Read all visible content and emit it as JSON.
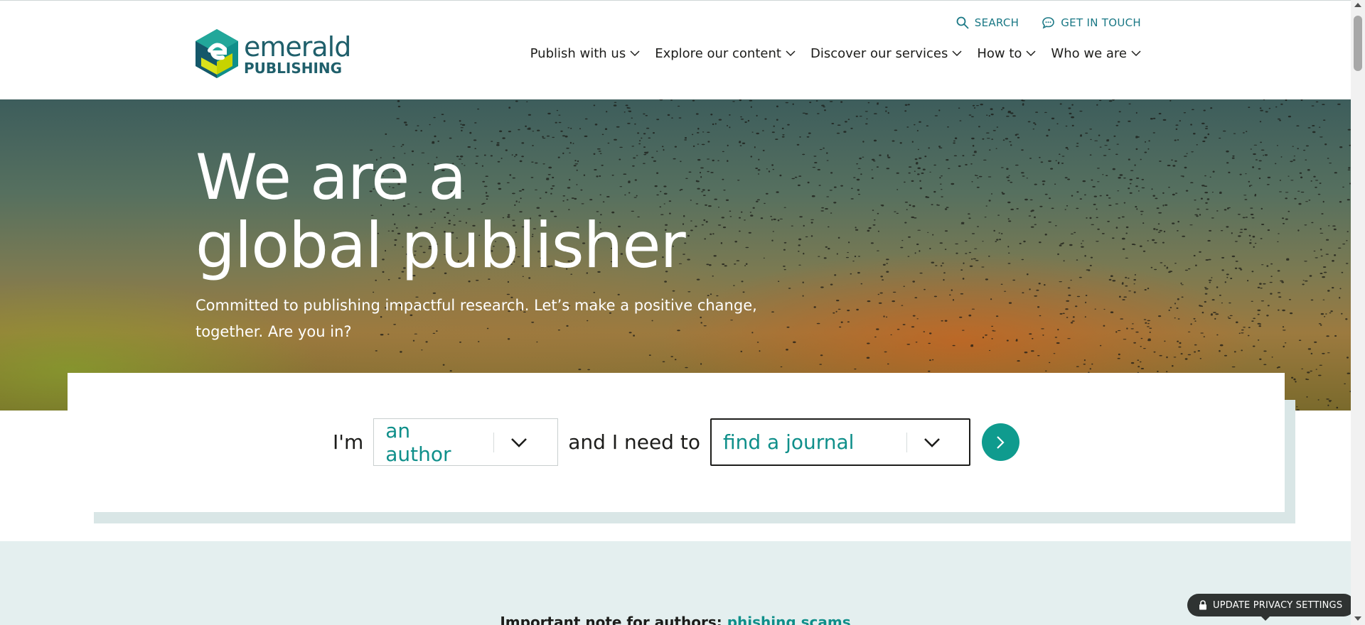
{
  "brand": {
    "word1": "emerald",
    "word2": "PUBLISHING",
    "colors": {
      "teal": "#1f5f6b",
      "accent": "#0f9b8e",
      "green": "#c7d300"
    }
  },
  "utility": {
    "search_label": "SEARCH",
    "contact_label": "GET IN TOUCH"
  },
  "nav": {
    "items": [
      {
        "label": "Publish with us"
      },
      {
        "label": "Explore our content"
      },
      {
        "label": "Discover our services"
      },
      {
        "label": "How to"
      },
      {
        "label": "Who we are"
      }
    ]
  },
  "hero": {
    "title_line1": "We are a",
    "title_line2": "global publisher",
    "subtitle": "Committed to publishing impactful research. Let’s make a positive change, together. Are you in?"
  },
  "selector": {
    "prefix": "I'm",
    "role_value": "an author",
    "middle": "and I need to",
    "task_value": "find a journal"
  },
  "notice": {
    "text": "Important note for authors: ",
    "link": "phishing scams"
  },
  "privacy": {
    "label": "UPDATE PRIVACY SETTINGS"
  }
}
